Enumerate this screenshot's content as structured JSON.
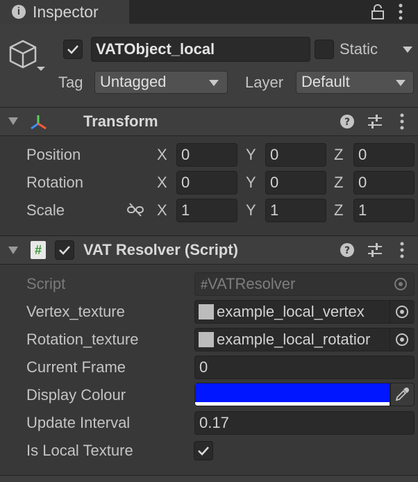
{
  "tab": {
    "title": "Inspector"
  },
  "object": {
    "name": "VATObject_local",
    "active": true,
    "static_label": "Static",
    "static_checked": false,
    "tag_label": "Tag",
    "tag_value": "Untagged",
    "layer_label": "Layer",
    "layer_value": "Default"
  },
  "transform": {
    "title": "Transform",
    "rows": [
      {
        "label": "Position",
        "x": "0",
        "y": "0",
        "z": "0"
      },
      {
        "label": "Rotation",
        "x": "0",
        "y": "0",
        "z": "0"
      },
      {
        "label": "Scale",
        "x": "1",
        "y": "1",
        "z": "1"
      }
    ],
    "axes": {
      "x": "X",
      "y": "Y",
      "z": "Z"
    }
  },
  "script_component": {
    "title": "VAT Resolver (Script)",
    "enabled": true,
    "script_label": "Script",
    "script_value": "VATResolver",
    "vertex_label": "Vertex_texture",
    "vertex_value": "example_local_vertex",
    "rotation_label": "Rotation_texture",
    "rotation_value": "example_local_rotatior",
    "frame_label": "Current Frame",
    "frame_value": "0",
    "colour_label": "Display Colour",
    "colour_value": "#0016ff",
    "interval_label": "Update Interval",
    "interval_value": "0.17",
    "local_label": "Is Local Texture",
    "local_checked": true
  },
  "icons": {
    "hash": "#"
  }
}
